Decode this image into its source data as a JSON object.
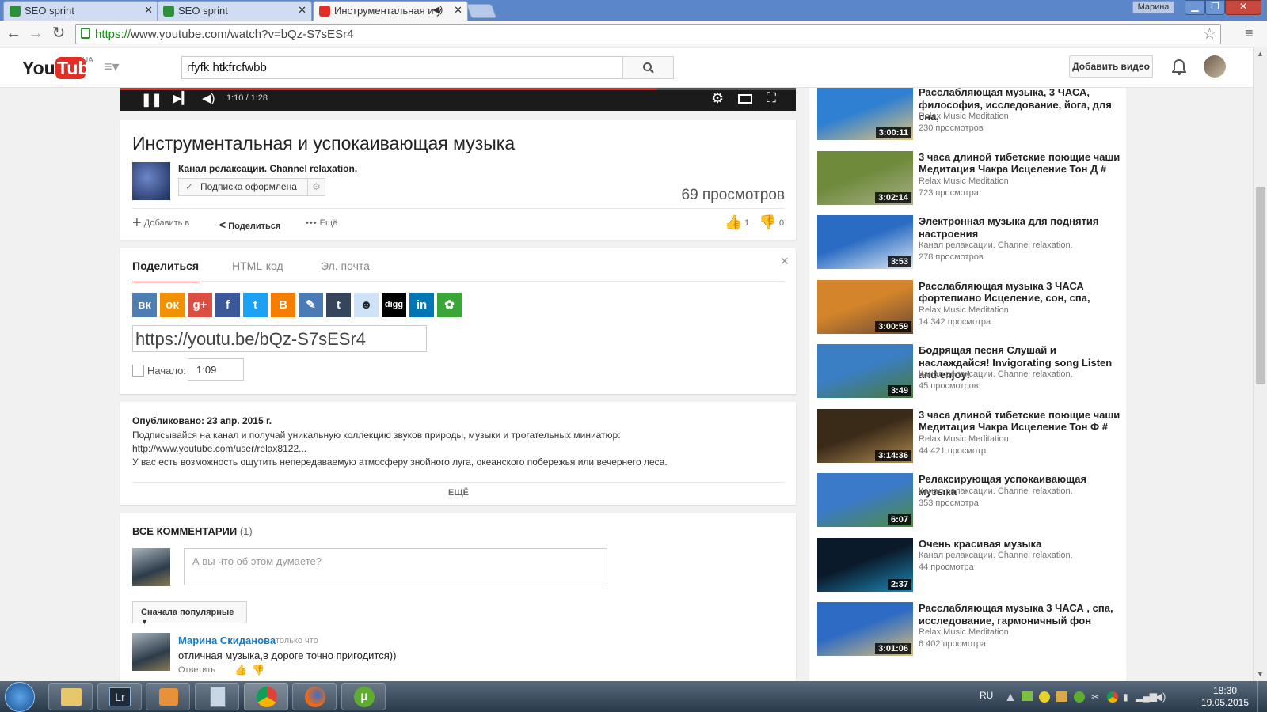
{
  "browser": {
    "tabs": [
      {
        "title": "SEO sprint"
      },
      {
        "title": "SEO sprint"
      },
      {
        "title": "Инструментальная и у"
      }
    ],
    "profile": "Марина",
    "url_scheme": "https://",
    "url_rest": "www.youtube.com/watch?v=bQz-S7sESr4"
  },
  "yt": {
    "region": "UA",
    "search_value": "rfyfk htkfrcfwbb",
    "add_video": "Добавить видео"
  },
  "player": {
    "time": "1:10 / 1:28",
    "progress": 0.795
  },
  "video": {
    "title": "Инструментальная и успокаивающая музыка",
    "channel": "Канал релаксации. Channel relaxation.",
    "subscribe": "Подписка оформлена",
    "views": "69 просмотров",
    "add_to": "Добавить в",
    "share": "Поделиться",
    "more": "Ещё",
    "likes": "1",
    "dislikes": "0"
  },
  "share": {
    "tabs": [
      "Поделиться",
      "HTML-код",
      "Эл. почта"
    ],
    "link": "https://youtu.be/bQz-S7sESr4",
    "start_label": "Начало:",
    "start_value": "1:09",
    "icons": [
      {
        "name": "vk-icon",
        "glyph": "вк",
        "color": "#4e7db1"
      },
      {
        "name": "odnoklassniki-icon",
        "glyph": "ок",
        "color": "#f29100"
      },
      {
        "name": "googleplus-icon",
        "glyph": "g+",
        "color": "#dc4e41"
      },
      {
        "name": "facebook-icon",
        "glyph": "f",
        "color": "#3b5998"
      },
      {
        "name": "twitter-icon",
        "glyph": "t",
        "color": "#1da1f2"
      },
      {
        "name": "blogger-icon",
        "glyph": "B",
        "color": "#f57d00"
      },
      {
        "name": "livejournal-icon",
        "glyph": "✎",
        "color": "#4b7bb5"
      },
      {
        "name": "tumblr-icon",
        "glyph": "t",
        "color": "#35465c"
      },
      {
        "name": "reddit-icon",
        "glyph": "☻",
        "color": "#cee3f8"
      },
      {
        "name": "digg-icon",
        "glyph": "digg",
        "color": "#000000"
      },
      {
        "name": "linkedin-icon",
        "glyph": "in",
        "color": "#0077b5"
      },
      {
        "name": "stumbleupon-icon",
        "glyph": "✿",
        "color": "#3ba538"
      }
    ]
  },
  "desc": {
    "published": "Опубликовано: 23 апр. 2015 г.",
    "lines": [
      "Подписывайся на канал и получай уникальную коллекцию звуков природы, музыки и трогательных миниатюр:",
      "http://www.youtube.com/user/relax8122...",
      "У вас есть возможность ощутить непередаваемую атмосферу знойного луга, океанского побережья или вечернего леса."
    ],
    "more": "ЕЩЁ"
  },
  "comments": {
    "header": "ВСЕ КОММЕНТАРИИ",
    "count": "(1)",
    "placeholder": "А вы что об этом думаете?",
    "sort": "Сначала популярные",
    "items": [
      {
        "author": "Марина Скиданова",
        "time": "только что",
        "text": "отличная музыка,в дороге точно пригодится))",
        "reply": "Ответить"
      }
    ]
  },
  "sidebar": [
    {
      "title": "Расслабляющая музыка, 3 ЧАСА, философия, исследование, йога, для сна,",
      "channel": "Relax Music Meditation",
      "views": "230 просмотров",
      "dur": "3:00:11",
      "c1": "#2f7fd2",
      "c2": "#e2c57a"
    },
    {
      "title": "3 часа длиной тибетские поющие чаши Медитация Чакра Исцеление Тон Д #",
      "channel": "Relax Music Meditation",
      "views": "723 просмотра",
      "dur": "3:02:14",
      "c1": "#6e8a3a",
      "c2": "#a9b08c"
    },
    {
      "title": "Электронная музыка для поднятия настроения",
      "channel": "Канал релаксации. Channel relaxation.",
      "views": "278 просмотров",
      "dur": "3:53",
      "c1": "#2a6cc4",
      "c2": "#dfe9f2"
    },
    {
      "title": "Расслабляющая музыка 3 ЧАСА фортепиано Исцеление, сон, спа,",
      "channel": "Relax Music Meditation",
      "views": "14 342 просмотра",
      "dur": "3:00:59",
      "c1": "#d4842a",
      "c2": "#6a4a33"
    },
    {
      "title": "Бодрящая песня Слушай и наслаждайся! Invigorating song Listen and enjoy!",
      "channel": "Канал релаксации. Channel relaxation.",
      "views": "45 просмотров",
      "dur": "3:49",
      "c1": "#3a7ec4",
      "c2": "#4a7a3a"
    },
    {
      "title": "3 часа длиной тибетские поющие чаши Медитация Чакра Исцеление Тон Ф #",
      "channel": "Relax Music Meditation",
      "views": "44 421 просмотр",
      "dur": "3:14:36",
      "c1": "#3a2a18",
      "c2": "#b08b50"
    },
    {
      "title": "Релаксирующая успокаивающая музыка",
      "channel": "Канал релаксации. Channel relaxation.",
      "views": "353 просмотра",
      "dur": "6:07",
      "c1": "#3b7ac8",
      "c2": "#4f8c3f"
    },
    {
      "title": "Очень красивая музыка",
      "channel": "Канал релаксации. Channel relaxation.",
      "views": "44 просмотра",
      "dur": "2:37",
      "c1": "#0b1a2a",
      "c2": "#1e88b8"
    },
    {
      "title": "Расслабляющая музыка 3 ЧАСА , спа, исследование, гармоничный фон",
      "channel": "Relax Music Meditation",
      "views": "6 402 просмотра",
      "dur": "3:01:06",
      "c1": "#2e6bc4",
      "c2": "#d9c07a"
    }
  ],
  "taskbar": {
    "lang": "RU",
    "time": "18:30",
    "date": "19.05.2015"
  }
}
